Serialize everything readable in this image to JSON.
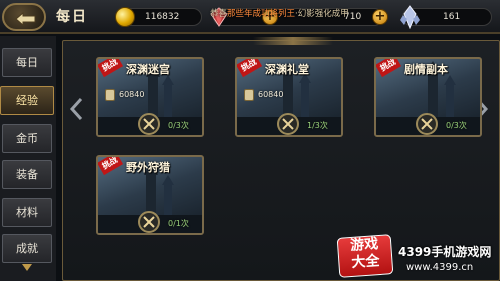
{
  "header": {
    "title": "每日",
    "gold": "116832",
    "gems": "710",
    "crystals": "161",
    "marquee_prefix": "恭喜",
    "marquee_name": "那些年成功将列王",
    "marquee_suffix": "·幻影强化成甲"
  },
  "sidebar": {
    "items": [
      {
        "label": "每日"
      },
      {
        "label": "经验"
      },
      {
        "label": "金币"
      },
      {
        "label": "装备"
      },
      {
        "label": "材料"
      },
      {
        "label": "成就"
      }
    ],
    "active_index": 1
  },
  "cards": [
    {
      "badge": "挑战",
      "title": "深渊迷宫",
      "reward": "60840",
      "attempts": "0/3次"
    },
    {
      "badge": "挑战",
      "title": "深渊礼堂",
      "reward": "60840",
      "attempts": "1/3次"
    },
    {
      "badge": "挑战",
      "title": "剧情副本",
      "reward": "",
      "attempts": "0/3次"
    },
    {
      "badge": "挑战",
      "title": "野外狩猎",
      "reward": "",
      "attempts": "0/1次"
    }
  ],
  "watermark": {
    "badge_top": "游戏",
    "badge_bottom": "大全",
    "site_name": "4399手机游戏网",
    "site_url": "www.4399.cn"
  },
  "colors": {
    "accent": "#c09a4a",
    "ribbon": "#c01616",
    "attempts": "#9ad17a"
  }
}
